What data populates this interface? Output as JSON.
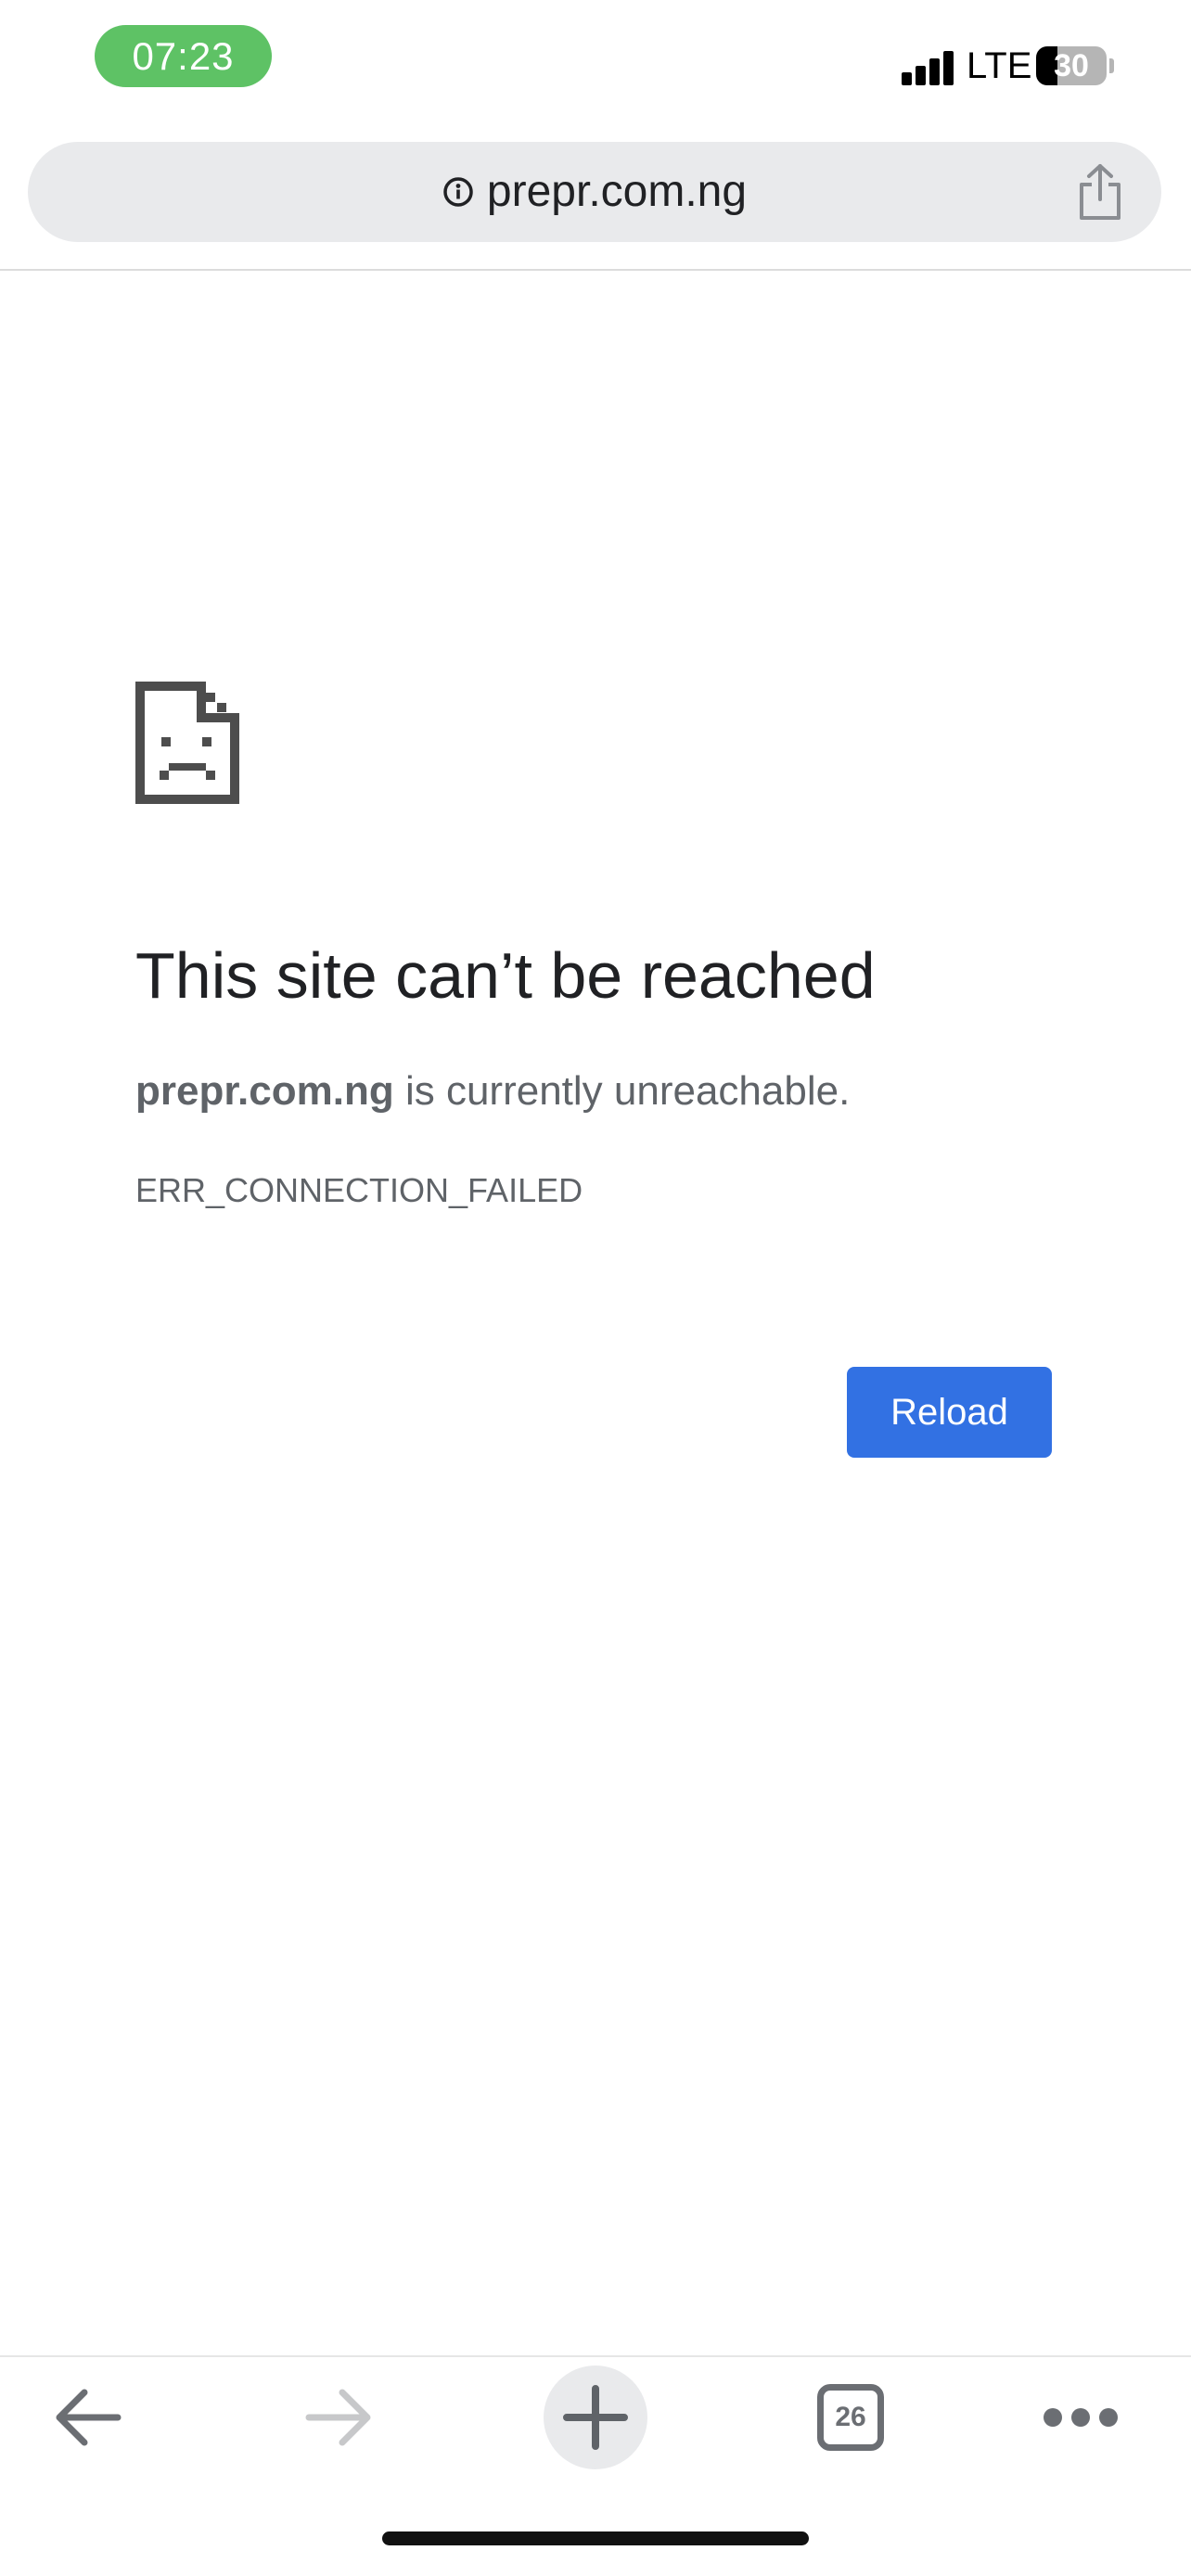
{
  "status_bar": {
    "time": "07:23",
    "network": "LTE",
    "battery_percent": "30",
    "battery_level": 0.3,
    "time_pill_color": "#5ec265"
  },
  "address_bar": {
    "url": "prepr.com.ng",
    "site_info_icon": "info-icon",
    "share_icon": "share-icon"
  },
  "error_page": {
    "icon": "sad-document-icon",
    "title": "This site can’t be reached",
    "host": "prepr.com.ng",
    "description_suffix": " is currently unreachable.",
    "error_code": "ERR_CONNECTION_FAILED",
    "reload_label": "Reload",
    "reload_color": "#3271e3"
  },
  "bottom_toolbar": {
    "back_icon": "back-arrow-icon",
    "forward_icon": "forward-arrow-icon",
    "new_tab_icon": "plus-icon",
    "tab_count": "26",
    "more_icon": "more-dots-icon"
  }
}
